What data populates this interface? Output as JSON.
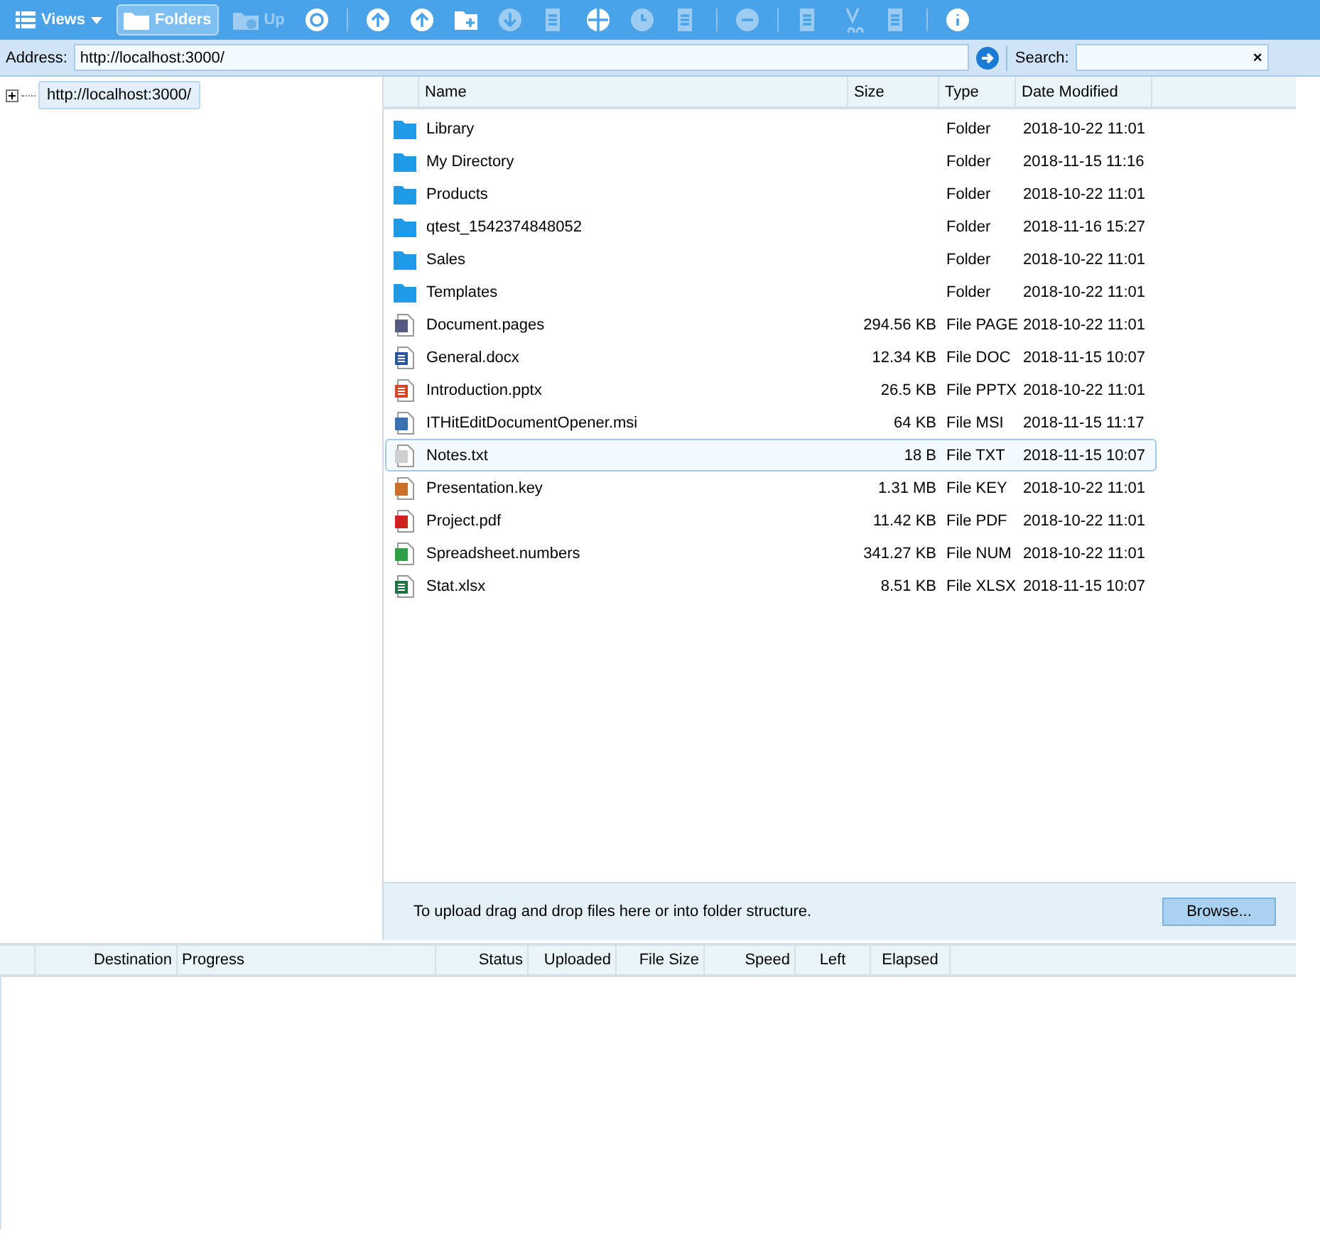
{
  "toolbar": [
    {
      "kind": "dropdown",
      "label": "Views",
      "disabled": false,
      "selected": false
    },
    {
      "kind": "toggle",
      "label": "Folders",
      "disabled": false,
      "selected": true
    },
    {
      "kind": "button",
      "label": "Up",
      "disabled": true,
      "selected": false
    },
    {
      "kind": "icon",
      "disabled": false
    },
    {
      "kind": "separator"
    },
    {
      "kind": "icon",
      "disabled": false
    },
    {
      "kind": "icon",
      "disabled": false
    },
    {
      "kind": "icon",
      "disabled": false
    },
    {
      "kind": "icon",
      "disabled": true
    },
    {
      "kind": "icon",
      "disabled": true
    },
    {
      "kind": "icon",
      "disabled": false
    },
    {
      "kind": "icon",
      "disabled": true
    },
    {
      "kind": "icon",
      "disabled": true
    },
    {
      "kind": "separator"
    },
    {
      "kind": "icon",
      "disabled": true
    },
    {
      "kind": "separator"
    },
    {
      "kind": "icon",
      "disabled": true
    },
    {
      "kind": "icon",
      "disabled": true
    },
    {
      "kind": "icon",
      "disabled": true
    },
    {
      "kind": "separator"
    },
    {
      "kind": "icon",
      "disabled": false
    }
  ],
  "address": {
    "label": "Address:",
    "value": "http://localhost:3000/"
  },
  "search": {
    "label": "Search:",
    "clear": "×"
  },
  "tree": [
    {
      "label": "http://localhost:3000/",
      "selected": true,
      "expanded": false
    }
  ],
  "file_list": {
    "columns": [
      "Name",
      "Size",
      "Type",
      "Date Modified"
    ],
    "rows": [
      {
        "kind": "folder",
        "name": "Library",
        "size": "",
        "type": "Folder",
        "modified": "2018-10-22 11:01",
        "selected": false
      },
      {
        "kind": "folder",
        "name": "My Directory",
        "size": "",
        "type": "Folder",
        "modified": "2018-11-15 11:16",
        "selected": false
      },
      {
        "kind": "folder",
        "name": "Products",
        "size": "",
        "type": "Folder",
        "modified": "2018-10-22 11:01",
        "selected": false
      },
      {
        "kind": "folder",
        "name": "qtest_1542374848052",
        "size": "",
        "type": "Folder",
        "modified": "2018-11-16 15:27",
        "selected": false
      },
      {
        "kind": "folder",
        "name": "Sales",
        "size": "",
        "type": "Folder",
        "modified": "2018-10-22 11:01",
        "selected": false
      },
      {
        "kind": "folder",
        "name": "Templates",
        "size": "",
        "type": "Folder",
        "modified": "2018-10-22 11:01",
        "selected": false
      },
      {
        "kind": "pages",
        "name": "Document.pages",
        "size": "294.56 KB",
        "type": "File PAGE",
        "modified": "2018-10-22 11:01",
        "selected": false
      },
      {
        "kind": "word",
        "name": "General.docx",
        "size": "12.34 KB",
        "type": "File DOC",
        "modified": "2018-11-15 10:07",
        "selected": false
      },
      {
        "kind": "powerpoint",
        "name": "Introduction.pptx",
        "size": "26.5 KB",
        "type": "File PPTX",
        "modified": "2018-10-22 11:01",
        "selected": false
      },
      {
        "kind": "installer",
        "name": "ITHitEditDocumentOpener.msi",
        "size": "64 KB",
        "type": "File MSI",
        "modified": "2018-11-15 11:17",
        "selected": false
      },
      {
        "kind": "text",
        "name": "Notes.txt",
        "size": "18 B",
        "type": "File TXT",
        "modified": "2018-11-15 10:07",
        "selected": true
      },
      {
        "kind": "keynote",
        "name": "Presentation.key",
        "size": "1.31 MB",
        "type": "File KEY",
        "modified": "2018-10-22 11:01",
        "selected": false
      },
      {
        "kind": "pdf",
        "name": "Project.pdf",
        "size": "11.42 KB",
        "type": "File PDF",
        "modified": "2018-10-22 11:01",
        "selected": false
      },
      {
        "kind": "numbers",
        "name": "Spreadsheet.numbers",
        "size": "341.27 KB",
        "type": "File NUM",
        "modified": "2018-10-22 11:01",
        "selected": false
      },
      {
        "kind": "excel",
        "name": "Stat.xlsx",
        "size": "8.51 KB",
        "type": "File XLSX",
        "modified": "2018-11-15 10:07",
        "selected": false
      }
    ]
  },
  "upload_zone": {
    "hint": "To upload drag and drop files here or into folder structure.",
    "button": "Browse..."
  },
  "upload_queue": {
    "columns": [
      "Destination",
      "Progress",
      "Status",
      "Uploaded",
      "File Size",
      "Speed",
      "Left",
      "Elapsed"
    ]
  }
}
